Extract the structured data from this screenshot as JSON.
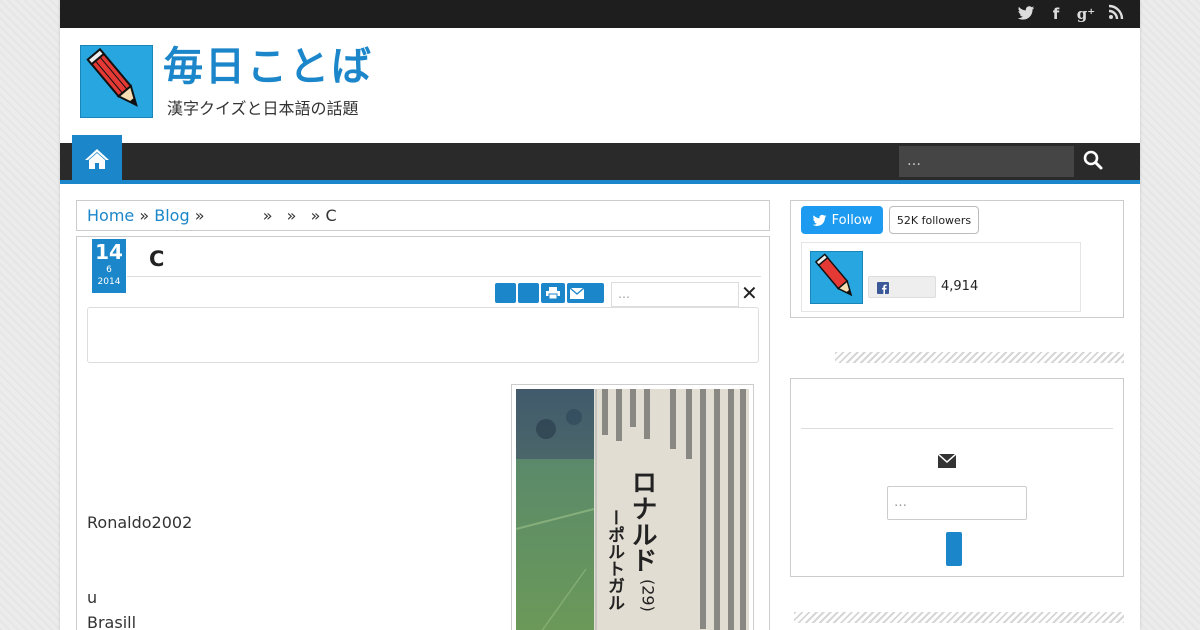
{
  "topbar": {
    "social_icons": [
      "twitter-icon",
      "facebook-icon",
      "google-plus-icon",
      "rss-icon"
    ],
    "social_glyphs": [
      "",
      "f",
      "g⁺",
      ""
    ]
  },
  "header": {
    "title": "毎日ことば",
    "description": "漢字クイズと日本語の話題"
  },
  "nav": {
    "search_placeholder": "…"
  },
  "breadcrumb": {
    "home": "Home",
    "blog": "Blog",
    "sep": "»",
    "current": "C"
  },
  "post": {
    "day": "14",
    "month": "6",
    "year": "2014",
    "title": "C",
    "search_placeholder": "…",
    "close": "✕",
    "body_lines": [
      "Ronaldo2002",
      "u",
      "Brasill"
    ],
    "photo_text_large": "ロナルド",
    "photo_text_age": "(29)",
    "photo_text_country": "ーポルトガル"
  },
  "sidebar": {
    "follow_label": "Follow",
    "followers": "52K followers",
    "fb_count": "4,914",
    "email_placeholder": "…"
  },
  "colors": {
    "accent": "#1b86c9",
    "topbar": "#1e1e1e",
    "nav": "#2a2a2a",
    "twitter": "#1d9bf0"
  }
}
